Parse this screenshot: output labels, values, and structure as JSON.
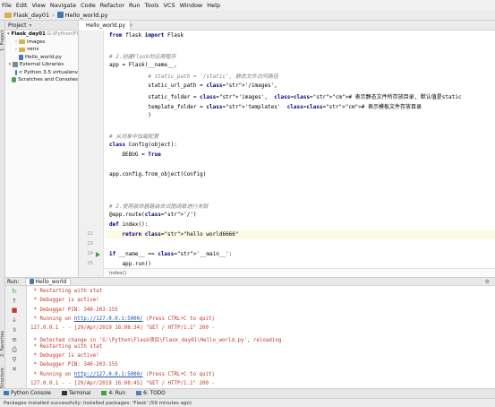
{
  "menu": [
    "File",
    "Edit",
    "View",
    "Navigate",
    "Code",
    "Refactor",
    "Run",
    "Tools",
    "VCS",
    "Window",
    "Help"
  ],
  "breadcrumb": {
    "project": "Flask_day01",
    "file": "Hello_world.py"
  },
  "left_strip": {
    "project_tab": "1: Project",
    "structure_tab": "7: Structure",
    "favorites_tab": "2: Favorites"
  },
  "project_panel": {
    "title": "Project",
    "tree": [
      {
        "label": "Flask_day01",
        "suffix": "G:\\Python\\Flask\\...",
        "kind": "folder-open",
        "depth": 0,
        "bold": true
      },
      {
        "label": "images",
        "kind": "folder",
        "depth": 1
      },
      {
        "label": "venv",
        "kind": "folder",
        "depth": 1
      },
      {
        "label": "Hello_world.py",
        "kind": "py",
        "depth": 1
      },
      {
        "label": "External Libraries",
        "kind": "lib",
        "depth": 0
      },
      {
        "label": "< Python 3.5 virtualenv",
        "kind": "py",
        "depth": 1
      },
      {
        "label": "Scratches and Consoles",
        "kind": "scratch",
        "depth": 0
      }
    ]
  },
  "editor": {
    "tab": "Hello_world.py",
    "lines": [
      {
        "n": "",
        "t": "from flask import Flask"
      },
      {
        "n": "",
        "t": ""
      },
      {
        "n": "",
        "t": "# 2.创建Flask的应用程序"
      },
      {
        "n": "",
        "t": "app = Flask(__name__,"
      },
      {
        "n": "",
        "t": "            # static_path = '/static', 静态文件访问路径"
      },
      {
        "n": "",
        "t": "            static_url_path = '/images',"
      },
      {
        "n": "",
        "t": "            static_folder = 'images',  # 表示静态文件所存放目录, 默认值是static"
      },
      {
        "n": "",
        "t": "            template_folder = 'templates'  # 表示模板文件存放目录"
      },
      {
        "n": "",
        "t": "            )"
      },
      {
        "n": "",
        "t": ""
      },
      {
        "n": "",
        "t": "# 从对象中加载配置"
      },
      {
        "n": "",
        "t": "class Config(object):"
      },
      {
        "n": "",
        "t": "    DEBUG = True"
      },
      {
        "n": "",
        "t": ""
      },
      {
        "n": "",
        "t": "app.config.from_object(Config)"
      },
      {
        "n": "",
        "t": ""
      },
      {
        "n": "",
        "t": ""
      },
      {
        "n": "",
        "t": "# 2.使用装饰器路由去试图函数进行关联"
      },
      {
        "n": "",
        "t": "@app.route('/')"
      },
      {
        "n": "",
        "t": "def index():"
      },
      {
        "n": "22",
        "t": "    return \"hello world6666\""
      },
      {
        "n": "23",
        "t": ""
      },
      {
        "n": "24",
        "t": "if __name__ == '__main__':"
      },
      {
        "n": "25",
        "t": "    app.run()"
      }
    ],
    "footer": "index()"
  },
  "run_panel": {
    "label": "Run:",
    "tab": "Hello_world",
    "lines": [
      " * Restarting with stat",
      " * Debugger is active!",
      " * Debugger PIN: 340-203-155",
      " * Running on |http://127.0.0.1:5000/| (Press CTRL+C to quit)",
      "127.0.0.1 - - [29/Apr/2019 16:08:34] \"GET / HTTP/1.1\" 200 -",
      " * Detected change in 'G:\\Python\\Flask项目\\Flask_day01\\Hello_world.py', reloading",
      " * Restarting with stat",
      " * Debugger is active!",
      " * Debugger PIN: 340-203-155",
      " * Running on |http://127.0.0.1:5000/| (Press CTRL+C to quit)",
      "127.0.0.1 - - [29/Apr/2019 16:08:45] \"GET / HTTP/1.1\" 200 -"
    ]
  },
  "bottom_tabs": [
    "Python Console",
    "Terminal",
    "4: Run",
    "6: TODO"
  ],
  "status": "Packages installed successfully: Installed packages: 'Flask' (59 minutes ago)"
}
